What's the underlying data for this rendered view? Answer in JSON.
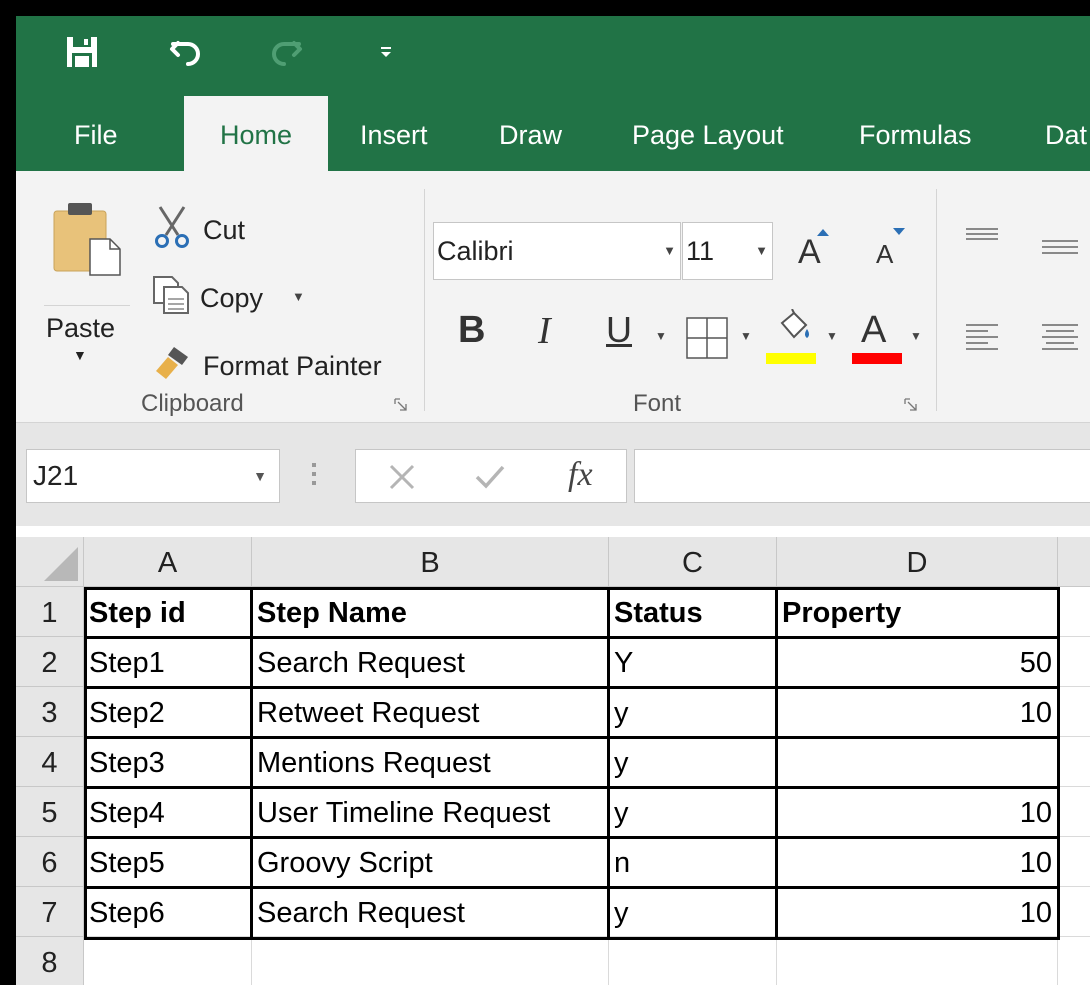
{
  "quick_access": {
    "save_icon": "save-icon",
    "undo_icon": "undo-icon",
    "redo_icon": "redo-icon",
    "customize_icon": "customize-qat-icon"
  },
  "tabs": [
    {
      "label": "File"
    },
    {
      "label": "Home"
    },
    {
      "label": "Insert"
    },
    {
      "label": "Draw"
    },
    {
      "label": "Page Layout"
    },
    {
      "label": "Formulas"
    },
    {
      "label": "Dat"
    }
  ],
  "clipboard": {
    "paste_label": "Paste",
    "cut_label": "Cut",
    "copy_label": "Copy",
    "format_painter_label": "Format Painter",
    "group_label": "Clipboard"
  },
  "font": {
    "font_name": "Calibri",
    "font_size": "11",
    "bold_label": "B",
    "italic_label": "I",
    "underline_label": "U",
    "font_color_label": "A",
    "grow_label": "A",
    "shrink_label": "A",
    "highlight_color": "#ffff00",
    "font_color": "#ff0000",
    "group_label": "Font"
  },
  "formula_bar": {
    "name_box": "J21",
    "fx_label": "fx",
    "formula_value": ""
  },
  "sheet": {
    "columns": [
      "A",
      "B",
      "C",
      "D"
    ],
    "row_numbers": [
      "1",
      "2",
      "3",
      "4",
      "5",
      "6",
      "7",
      "8"
    ],
    "rows": [
      [
        "Step id",
        "Step Name",
        "Status",
        "Property"
      ],
      [
        "Step1",
        "Search Request",
        "Y",
        "50"
      ],
      [
        "Step2",
        "Retweet Request",
        "y",
        "10"
      ],
      [
        "Step3",
        "Mentions Request",
        "y",
        ""
      ],
      [
        "Step4",
        "User Timeline Request",
        "y",
        "10"
      ],
      [
        "Step5",
        "Groovy Script",
        "n",
        "10"
      ],
      [
        "Step6",
        "Search Request",
        "y",
        "10"
      ],
      [
        "",
        "",
        "",
        ""
      ]
    ]
  },
  "colors": {
    "brand": "#217346",
    "ribbon_bg": "#f3f3f3",
    "header_bg": "#e6e6e6"
  }
}
